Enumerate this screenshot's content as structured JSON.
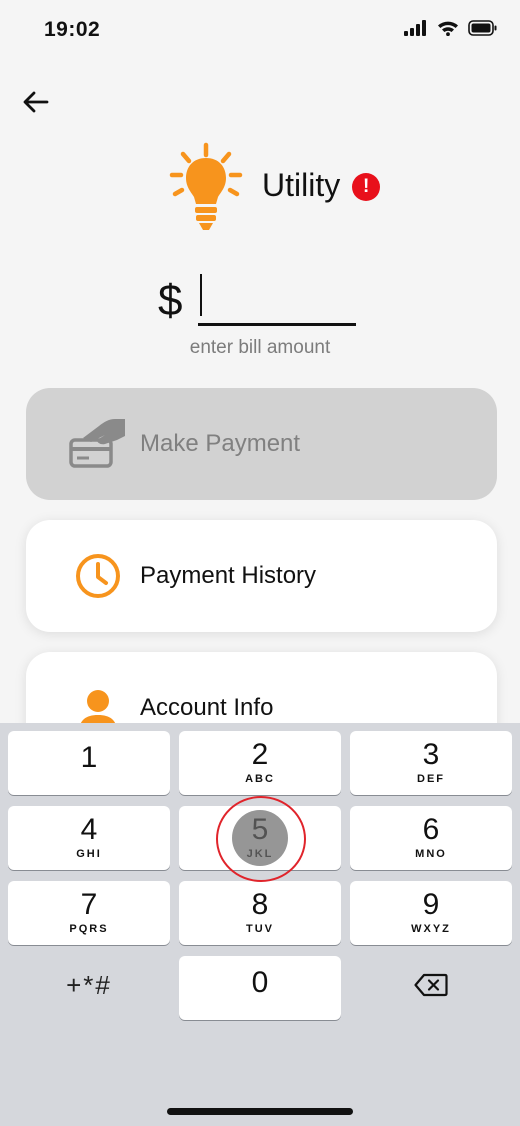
{
  "status_bar": {
    "time": "19:02",
    "icons": [
      "signal-icon",
      "wifi-icon",
      "battery-icon"
    ]
  },
  "header": {
    "title": "Utility",
    "alert_glyph": "!",
    "icon": "lightbulb-icon"
  },
  "amount": {
    "currency": "$",
    "value": "",
    "hint": "enter bill amount"
  },
  "actions": [
    {
      "label": "Make Payment",
      "icon": "card-payment-icon",
      "enabled": false
    },
    {
      "label": "Payment History",
      "icon": "clock-icon",
      "enabled": true
    },
    {
      "label": "Account Info",
      "icon": "person-icon",
      "enabled": true
    }
  ],
  "keypad": {
    "keys": [
      {
        "digit": "1",
        "letters": ""
      },
      {
        "digit": "2",
        "letters": "ABC"
      },
      {
        "digit": "3",
        "letters": "DEF"
      },
      {
        "digit": "4",
        "letters": "GHI"
      },
      {
        "digit": "5",
        "letters": "JKL"
      },
      {
        "digit": "6",
        "letters": "MNO"
      },
      {
        "digit": "7",
        "letters": "PQRS"
      },
      {
        "digit": "8",
        "letters": "TUV"
      },
      {
        "digit": "9",
        "letters": "WXYZ"
      },
      {
        "digit": "0",
        "letters": ""
      }
    ],
    "symbols": "+*#",
    "delete_icon": "backspace-icon"
  },
  "colors": {
    "accent": "#f7941d",
    "alert": "#e8101b",
    "background": "#f5f5f5",
    "keypad_bg": "#d5d7dc",
    "tap_ring": "#e0242b"
  }
}
